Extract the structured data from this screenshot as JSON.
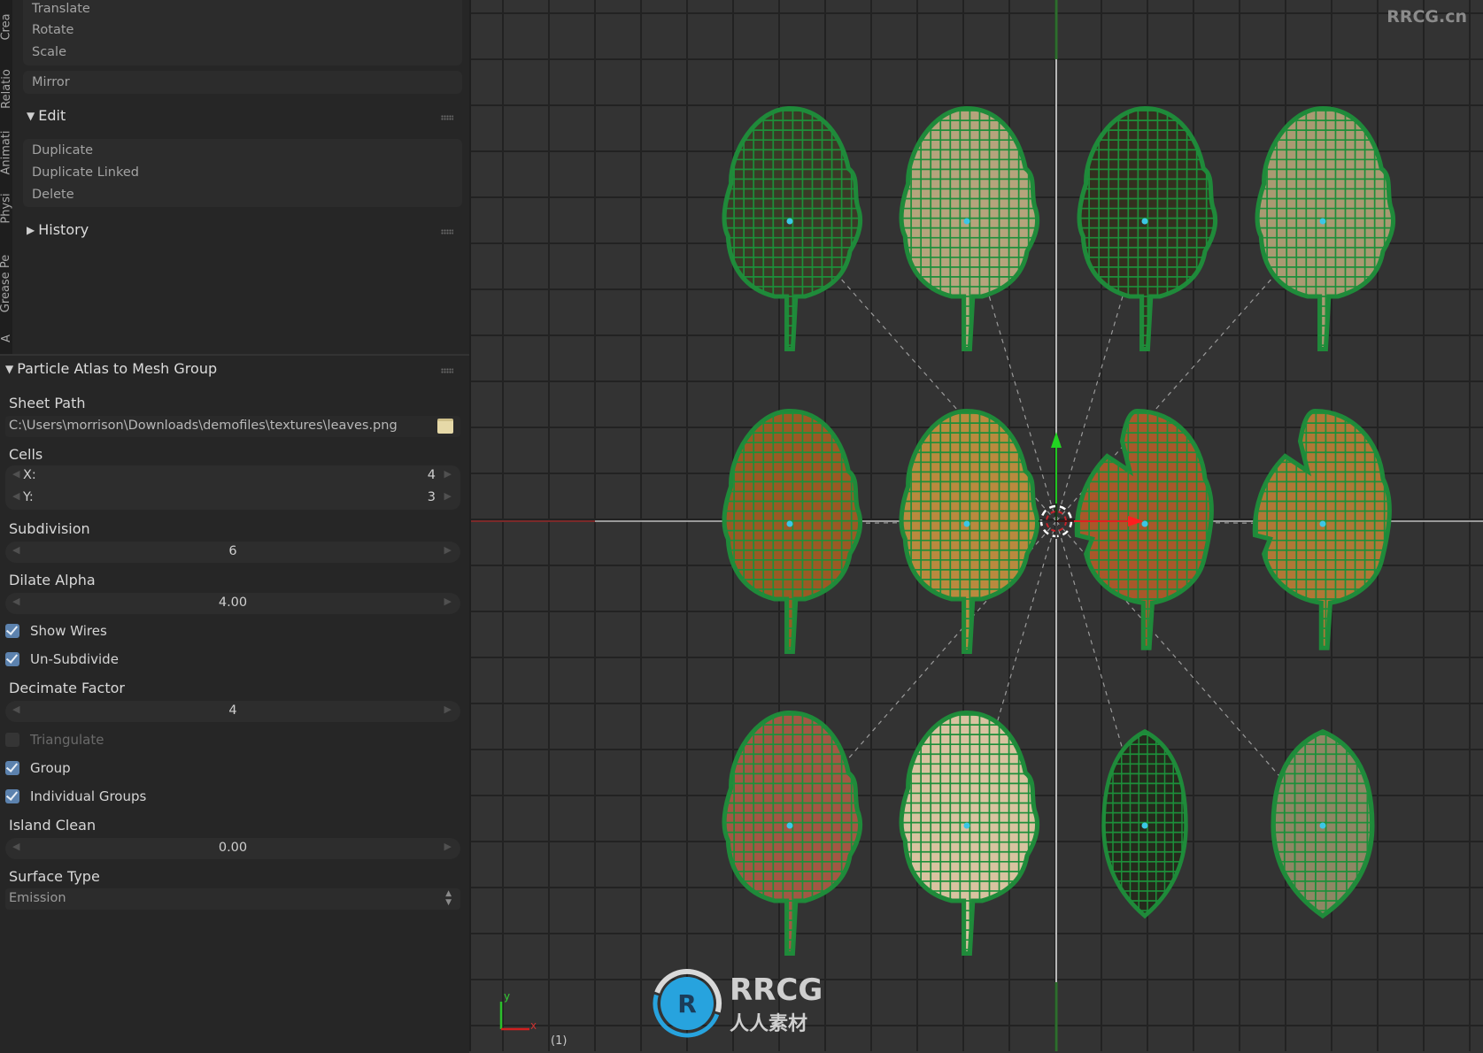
{
  "tool_tabs": [
    "Crea",
    "Relatio",
    "Animati",
    "Physi",
    "Grease Pe",
    "A"
  ],
  "transform_items": [
    "Translate",
    "Rotate",
    "Scale"
  ],
  "mirror_item": "Mirror",
  "edit_section": {
    "title": "Edit",
    "expanded": true,
    "items": [
      "Duplicate",
      "Duplicate Linked",
      "Delete"
    ]
  },
  "history_section": {
    "title": "History",
    "expanded": false
  },
  "addon_panel": {
    "title": "Particle Atlas to Mesh Group",
    "sheet_path_label": "Sheet Path",
    "sheet_path_value": "C:\\Users\\morrison\\Downloads\\demofiles\\textures\\leaves.png",
    "cells_label": "Cells",
    "cells_x_label": "X:",
    "cells_x_value": "4",
    "cells_y_label": "Y:",
    "cells_y_value": "3",
    "subdivision_label": "Subdivision",
    "subdivision_value": "6",
    "dilate_alpha_label": "Dilate Alpha",
    "dilate_alpha_value": "4.00",
    "show_wires_label": "Show Wires",
    "show_wires_checked": true,
    "unsubdivide_label": "Un-Subdivide",
    "unsubdivide_checked": true,
    "decimate_factor_label": "Decimate Factor",
    "decimate_factor_value": "4",
    "triangulate_label": "Triangulate",
    "triangulate_checked": false,
    "group_label": "Group",
    "group_checked": true,
    "individual_groups_label": "Individual Groups",
    "individual_groups_checked": true,
    "island_clean_label": "Island Clean",
    "island_clean_value": "0.00",
    "surface_type_label": "Surface Type",
    "surface_type_value": "Emission"
  },
  "viewport": {
    "frame_label": "(1)",
    "axis_x_label": "x",
    "axis_y_label": "y",
    "watermark_corner": "RRCG.cn",
    "watermark_center_en": "RRCG",
    "watermark_center_cn": "人人素材",
    "leaves": [
      {
        "row": 0,
        "col": 0,
        "fill": "#3a3a26",
        "shape": "oak"
      },
      {
        "row": 0,
        "col": 1,
        "fill": "#b5a47c",
        "shape": "oak"
      },
      {
        "row": 0,
        "col": 2,
        "fill": "#33301f",
        "shape": "oak"
      },
      {
        "row": 0,
        "col": 3,
        "fill": "#a99a72",
        "shape": "oak"
      },
      {
        "row": 1,
        "col": 0,
        "fill": "#9a5a24",
        "shape": "oak"
      },
      {
        "row": 1,
        "col": 1,
        "fill": "#b98a3e",
        "shape": "oak"
      },
      {
        "row": 1,
        "col": 2,
        "fill": "#a8582a",
        "shape": "notched"
      },
      {
        "row": 1,
        "col": 3,
        "fill": "#b07836",
        "shape": "notched"
      },
      {
        "row": 2,
        "col": 0,
        "fill": "#a25844",
        "shape": "oak"
      },
      {
        "row": 2,
        "col": 1,
        "fill": "#d8c3a0",
        "shape": "oak"
      },
      {
        "row": 2,
        "col": 2,
        "fill": "#252a1c",
        "shape": "ellipse"
      },
      {
        "row": 2,
        "col": 3,
        "fill": "#8e8764",
        "shape": "ellipse"
      }
    ]
  }
}
